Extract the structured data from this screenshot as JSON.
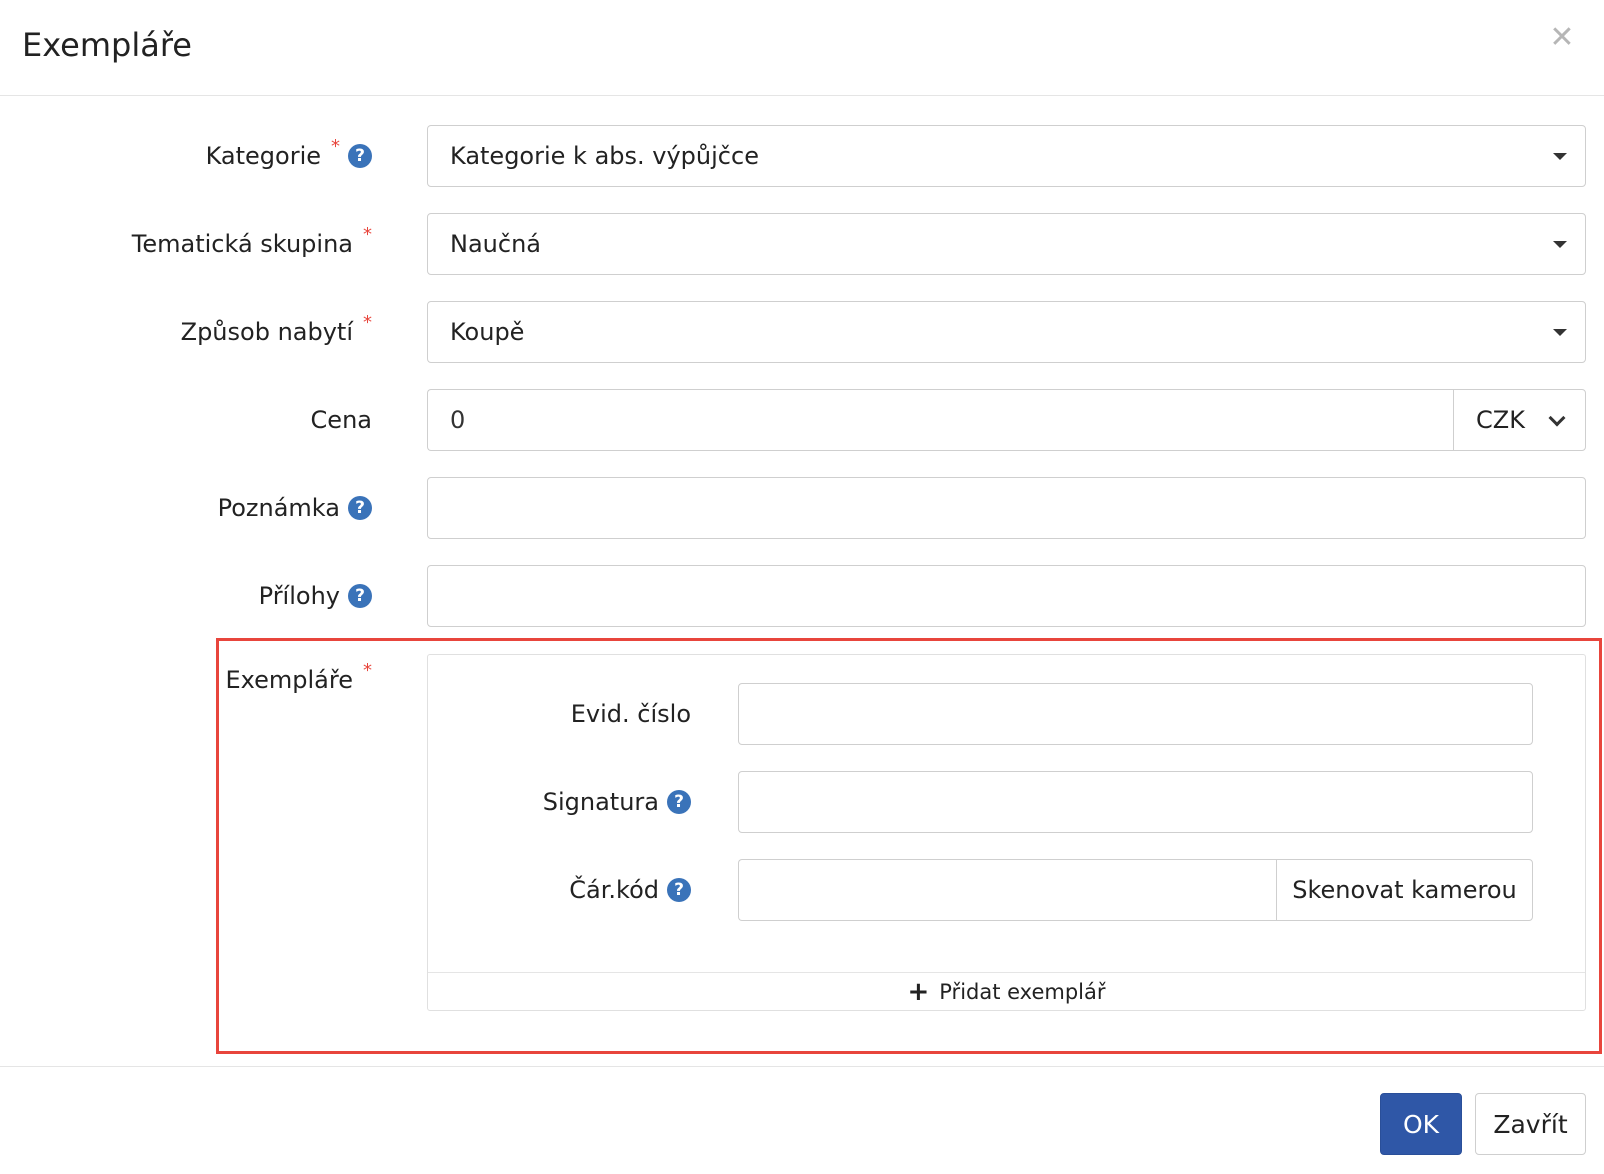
{
  "dialog": {
    "title": "Exempláře",
    "close_symbol": "✕"
  },
  "form": {
    "category": {
      "label": "Kategorie",
      "value": "Kategorie k abs. výpůjčce",
      "required": true,
      "help": true
    },
    "topic_group": {
      "label": "Tematická skupina",
      "value": "Naučná",
      "required": true
    },
    "acquisition": {
      "label": "Způsob nabytí",
      "value": "Koupě",
      "required": true
    },
    "price": {
      "label": "Cena",
      "value": "0",
      "currency": "CZK"
    },
    "note": {
      "label": "Poznámka",
      "value": "",
      "help": true
    },
    "attachments": {
      "label": "Přílohy",
      "value": "",
      "help": true
    }
  },
  "copies": {
    "label": "Exempláře",
    "required_mark": "*",
    "evid_number": {
      "label": "Evid. číslo",
      "value": ""
    },
    "signature": {
      "label": "Signatura",
      "value": ""
    },
    "barcode": {
      "label": "Čár.kód",
      "value": "",
      "scan_button": "Skenovat kamerou"
    },
    "add_button": "Přidat exemplář",
    "add_symbol": "+"
  },
  "footer": {
    "ok_label": "OK",
    "close_label": "Zavřít"
  },
  "icons": {
    "help": "help-icon",
    "help_glyph": "?",
    "close": "close-icon",
    "dropdown": "caret-down-icon",
    "plus": "plus-icon"
  },
  "colors": {
    "primary": "#2f57a7",
    "required": "#e8453c",
    "help": "#3a73b9",
    "highlight": "#e8453c"
  }
}
